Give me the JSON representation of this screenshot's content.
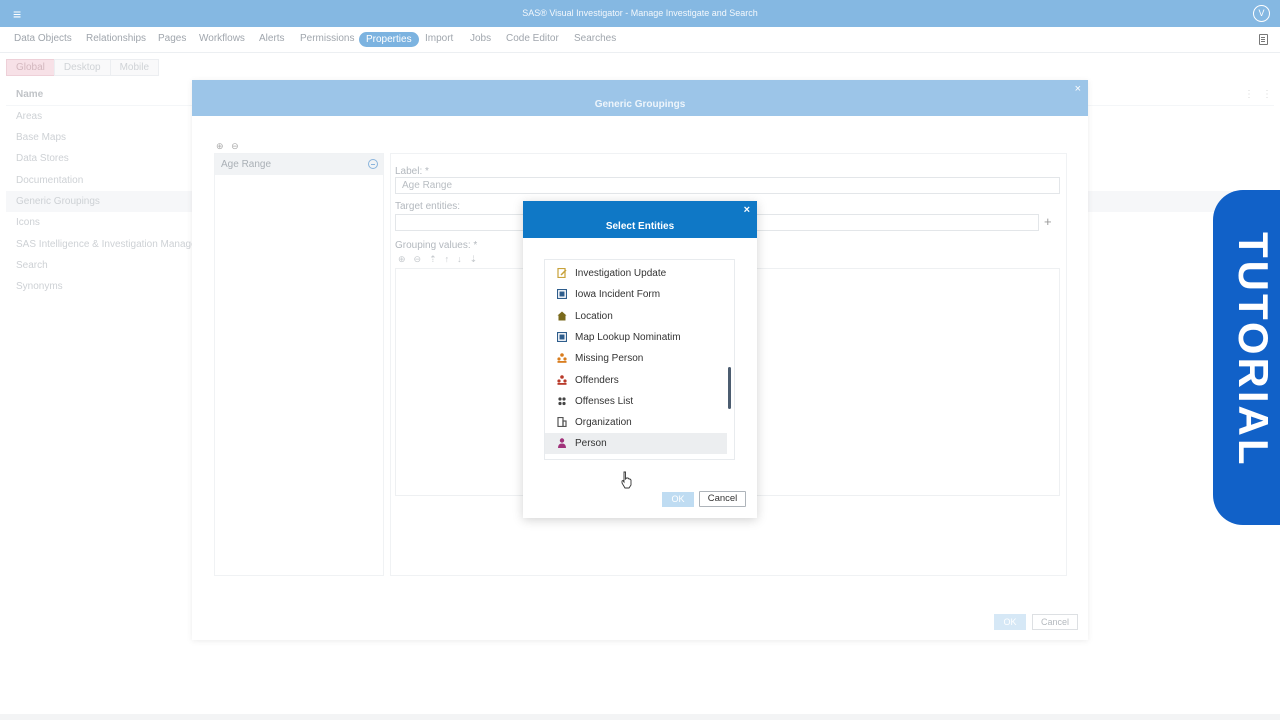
{
  "header": {
    "title": "SAS® Visual Investigator - Manage Investigate and Search",
    "avatar_letter": "V"
  },
  "nav": {
    "items": [
      "Data Objects",
      "Relationships",
      "Pages",
      "Workflows",
      "Alerts",
      "Permissions",
      "Properties",
      "Import",
      "Jobs",
      "Code Editor",
      "Searches"
    ],
    "active": "Properties"
  },
  "subtabs": [
    "Global",
    "Desktop",
    "Mobile"
  ],
  "list": {
    "header": "Name",
    "rows": [
      "Areas",
      "Base Maps",
      "Data Stores",
      "Documentation",
      "Generic Groupings",
      "Icons",
      "SAS Intelligence & Investigation Manager",
      "Search",
      "Synonyms"
    ],
    "selected": "Generic Groupings"
  },
  "groupings_dialog": {
    "title": "Generic Groupings",
    "close": "×",
    "group_item": "Age Range",
    "label_label": "Label: *",
    "label_value": "Age Range",
    "target_label": "Target entities:",
    "grouping_label": "Grouping values: *",
    "add_symbol": "+",
    "ok": "OK",
    "cancel": "Cancel"
  },
  "select_dialog": {
    "title": "Select Entities",
    "close": "×",
    "entities": [
      {
        "label": "Investigation Update",
        "icon": "document-edit-icon",
        "color": "#c7a23a"
      },
      {
        "label": "Iowa Incident Form",
        "icon": "form-icon",
        "color": "#2e5d8c"
      },
      {
        "label": "Location",
        "icon": "house-icon",
        "color": "#7a6a1c"
      },
      {
        "label": "Map Lookup Nominatim",
        "icon": "form-icon",
        "color": "#2e5d8c"
      },
      {
        "label": "Missing Person",
        "icon": "people-warning-icon",
        "color": "#d97d1e"
      },
      {
        "label": "Offenders",
        "icon": "people-icon",
        "color": "#b83a2a"
      },
      {
        "label": "Offenses List",
        "icon": "group-icon",
        "color": "#444444"
      },
      {
        "label": "Organization",
        "icon": "building-icon",
        "color": "#555555"
      },
      {
        "label": "Person",
        "icon": "person-icon",
        "color": "#a0327a"
      }
    ],
    "hovered": "Person",
    "ok": "OK",
    "cancel": "Cancel"
  },
  "banner": {
    "text": "TUTORIAL",
    "color": "#1161c8"
  }
}
